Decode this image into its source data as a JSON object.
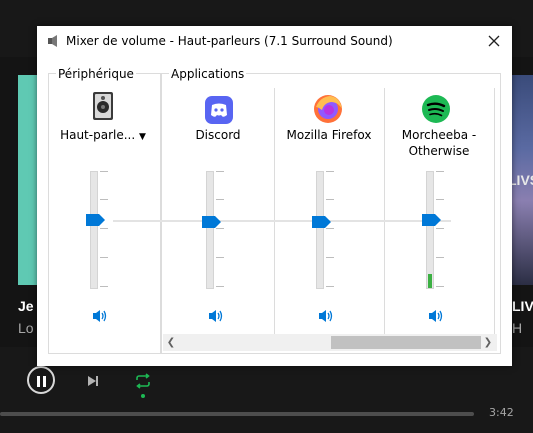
{
  "window": {
    "title": "Mixer de volume - Haut-parleurs (7.1 Surround Sound)",
    "close_label": "✕"
  },
  "groups": {
    "device_label": "Périphérique",
    "apps_label": "Applications"
  },
  "device": {
    "name": "Haut-parle...",
    "level": 0.0
  },
  "apps": [
    {
      "name": "Discord",
      "icon": "discord-icon",
      "level": 0.0
    },
    {
      "name": "Mozilla Firefox",
      "icon": "firefox-icon",
      "level": 0.0
    },
    {
      "name": "Morcheeba -\nOtherwise",
      "icon": "spotify-icon",
      "level": 0.12
    }
  ],
  "background": {
    "left_bold": "Je",
    "left_grey": "Lo",
    "right_bold": "LIV",
    "right_grey": "H",
    "art_right_text": "LIVS",
    "time": "3:42"
  },
  "colors": {
    "accent_blue": "#0078d7",
    "discord": "#5865f2",
    "spotify": "#1db954",
    "meter_green": "#3cb043"
  }
}
